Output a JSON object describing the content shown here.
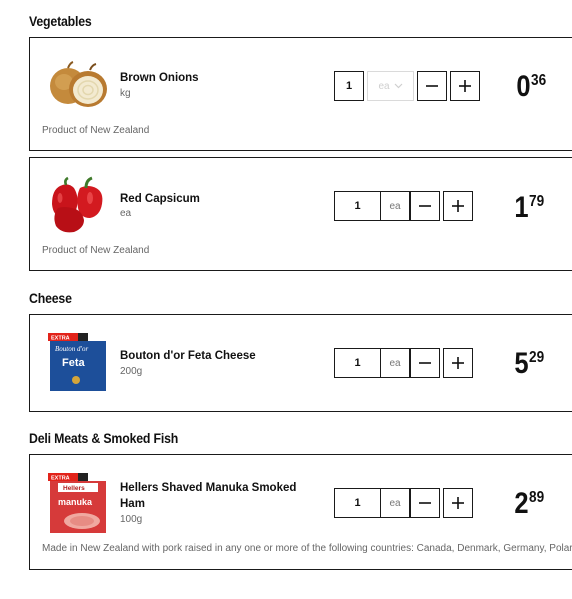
{
  "sections": [
    {
      "title": "Vegetables",
      "items": [
        {
          "name": "Brown Onions",
          "unit": "kg",
          "origin": "Product of New Zealand",
          "quantity": "1",
          "unit_select": "ea",
          "price_dollars": "0",
          "price_cents": "36"
        },
        {
          "name": "Red Capsicum",
          "unit": "ea",
          "origin": "Product of New Zealand",
          "quantity": "1",
          "unit_select": "ea",
          "price_dollars": "1",
          "price_cents": "79"
        }
      ]
    },
    {
      "title": "Cheese",
      "items": [
        {
          "name": "Bouton d'or Feta Cheese",
          "unit": "200g",
          "quantity": "1",
          "unit_select": "ea",
          "price_dollars": "5",
          "price_cents": "29",
          "badge": "EXTRA",
          "package_brand": "Bouton d'or",
          "package_label": "Feta"
        }
      ]
    },
    {
      "title": "Deli Meats & Smoked Fish",
      "items": [
        {
          "name_line1": "Hellers Shaved Manuka Smoked",
          "name_line2": "Ham",
          "unit": "100g",
          "origin": "Made in New Zealand with pork raised in any one or more of the following countries: Canada, Denmark, Germany, Polar",
          "quantity": "1",
          "unit_select": "ea",
          "price_dollars": "2",
          "price_cents": "89",
          "badge": "EXTRA",
          "package_brand": "Hellers",
          "package_label": "manuka"
        }
      ]
    }
  ],
  "icons": {
    "minus": "minus-icon",
    "plus": "plus-icon",
    "chevron": "chevron-down-icon"
  },
  "colors": {
    "badge_red": "#e2231a",
    "border": "#1a1a1a",
    "muted_text": "#666666"
  }
}
